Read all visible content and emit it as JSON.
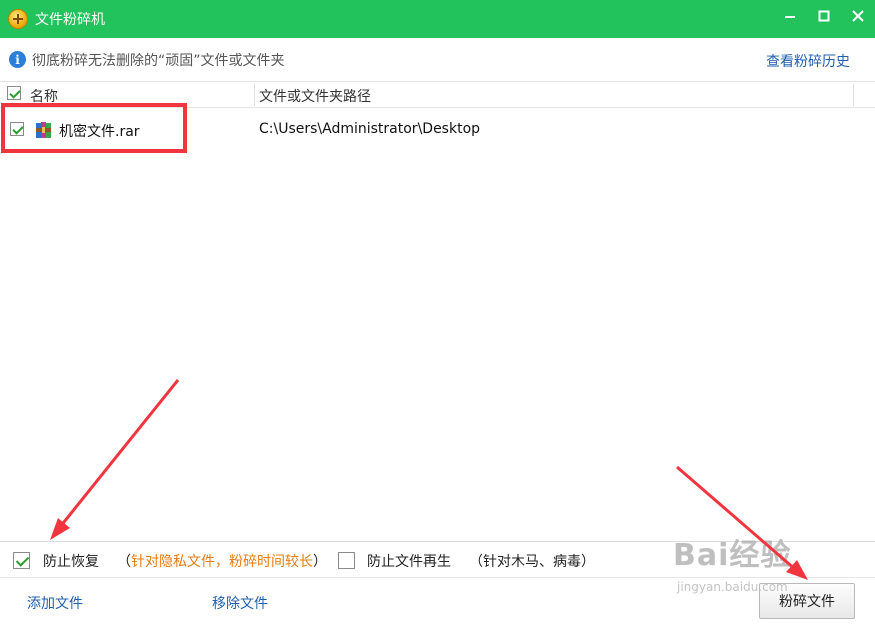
{
  "window": {
    "title": "文件粉碎机",
    "accent": "#22c35c"
  },
  "info": {
    "text": "彻底粉碎无法删除的“顽固”文件或文件夹",
    "history_link": "查看粉碎历史"
  },
  "list": {
    "columns": {
      "name": "名称",
      "path": "文件或文件夹路径"
    },
    "rows": [
      {
        "checked": true,
        "icon": "rar-archive-icon",
        "name": "机密文件.rar",
        "path": "C:\\Users\\Administrator\\Desktop"
      }
    ]
  },
  "options": {
    "prevent_recovery": {
      "checked": true,
      "label": "防止恢复",
      "open": "（",
      "note": "针对隐私文件，粉碎时间较长",
      "close": "）"
    },
    "prevent_regen": {
      "checked": false,
      "label": "防止文件再生",
      "note": "（针对木马、病毒）"
    }
  },
  "actions": {
    "add": "添加文件",
    "remove": "移除文件",
    "shred": "粉碎文件"
  },
  "watermark": {
    "main": "Bai经验",
    "sub": "jingyan.baidu.com"
  },
  "colors": {
    "link": "#1f5fae",
    "note": "#e87d12",
    "highlight": "#f0353f"
  }
}
